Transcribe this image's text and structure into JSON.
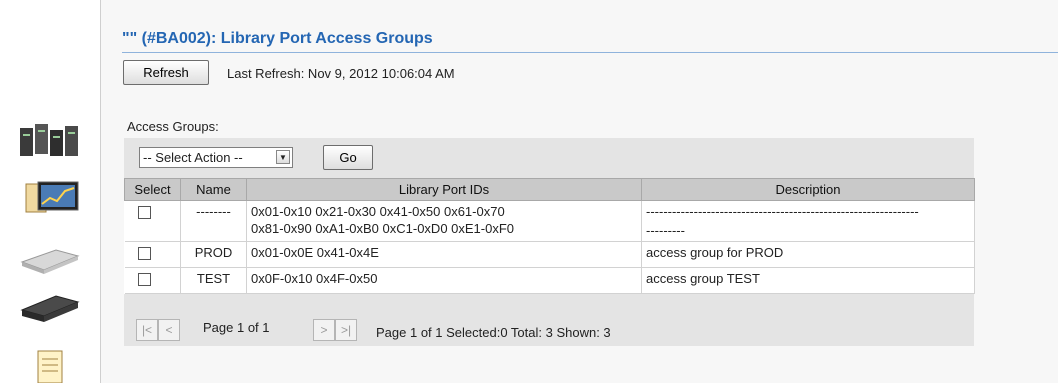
{
  "header": {
    "title": "\"\" (#BA002): Library Port Access Groups"
  },
  "toolbar": {
    "refresh_label": "Refresh",
    "last_refresh": "Last Refresh:  Nov 9, 2012 10:06:04 AM"
  },
  "groups": {
    "label": "Access Groups:",
    "action_select": "-- Select Action --",
    "go_label": "Go",
    "columns": [
      "Select",
      "Name",
      "Library Port IDs",
      "Description"
    ],
    "rows": [
      {
        "name": "--------",
        "port_ids": [
          "0x01-0x10 0x21-0x30 0x41-0x50 0x61-0x70",
          "0x81-0x90 0xA1-0xB0 0xC1-0xD0 0xE1-0xF0"
        ],
        "description": [
          "---------------------------------------------------------------",
          "---------"
        ]
      },
      {
        "name": "PROD",
        "port_ids": [
          "0x01-0x0E 0x41-0x4E"
        ],
        "description": [
          "access group for PROD"
        ]
      },
      {
        "name": "TEST",
        "port_ids": [
          "0x0F-0x10 0x4F-0x50"
        ],
        "description": [
          "access group TEST"
        ]
      }
    ],
    "pager": {
      "first": "|<",
      "prev": "<",
      "next": ">",
      "last": ">|",
      "page_label": "Page 1 of 1",
      "summary": "Page 1 of 1 Selected:0 Total: 3 Shown: 3"
    }
  },
  "sidebar": {
    "icons": [
      "servers-icon",
      "monitor-chart-icon",
      "tape-drive-icon",
      "tape-library-icon",
      "notepad-icon"
    ]
  }
}
